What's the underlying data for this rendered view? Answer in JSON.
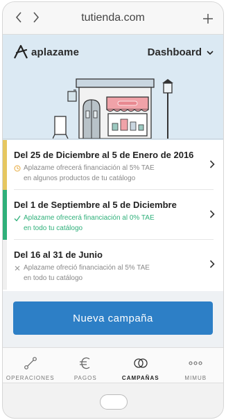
{
  "browser": {
    "url": "tutienda.com",
    "back_icon": "chevron-left-icon",
    "forward_icon": "chevron-right-icon",
    "new_tab_icon": "plus-icon"
  },
  "header": {
    "brand": "aplazame",
    "menu_label": "Dashboard"
  },
  "campaigns": [
    {
      "title": "Del 25 de Diciembre al 5 de Enero de 2016",
      "status_line": "Aplazame ofrecerá financiación al 5% TAE",
      "scope_line": "en algunos productos de tu catálogo",
      "status_icon": "clock-icon",
      "accent": "#e6c760",
      "text_color": "#888888"
    },
    {
      "title": "Del 1 de Septiembre al 5 de Diciembre",
      "status_line": "Aplazame ofrecerá financiación al 0% TAE",
      "scope_line": "en todo tu catálogo",
      "status_icon": "check-icon",
      "accent": "#2fb07a",
      "text_color": "#2fb07a"
    },
    {
      "title": "Del 16 al 31 de Junio",
      "status_line": "Aplazame ofreció financiación al 5% TAE",
      "scope_line": "en todo tu catálogo",
      "status_icon": "close-icon",
      "accent": "#dddddd",
      "text_color": "#888888"
    }
  ],
  "cta": {
    "label": "Nueva campaña"
  },
  "tabs": [
    {
      "label": "OPERACIONES",
      "icon": "operations-icon",
      "active": false
    },
    {
      "label": "PAGOS",
      "icon": "euro-icon",
      "active": false
    },
    {
      "label": "CAMPAÑAS",
      "icon": "campaigns-icon",
      "active": true
    },
    {
      "label": "MIMUB",
      "icon": "more-icon",
      "active": false
    }
  ],
  "colors": {
    "header_bg": "#dbe9f3",
    "primary": "#2d7fc6",
    "green": "#2fb07a",
    "yellow": "#e6c760"
  }
}
